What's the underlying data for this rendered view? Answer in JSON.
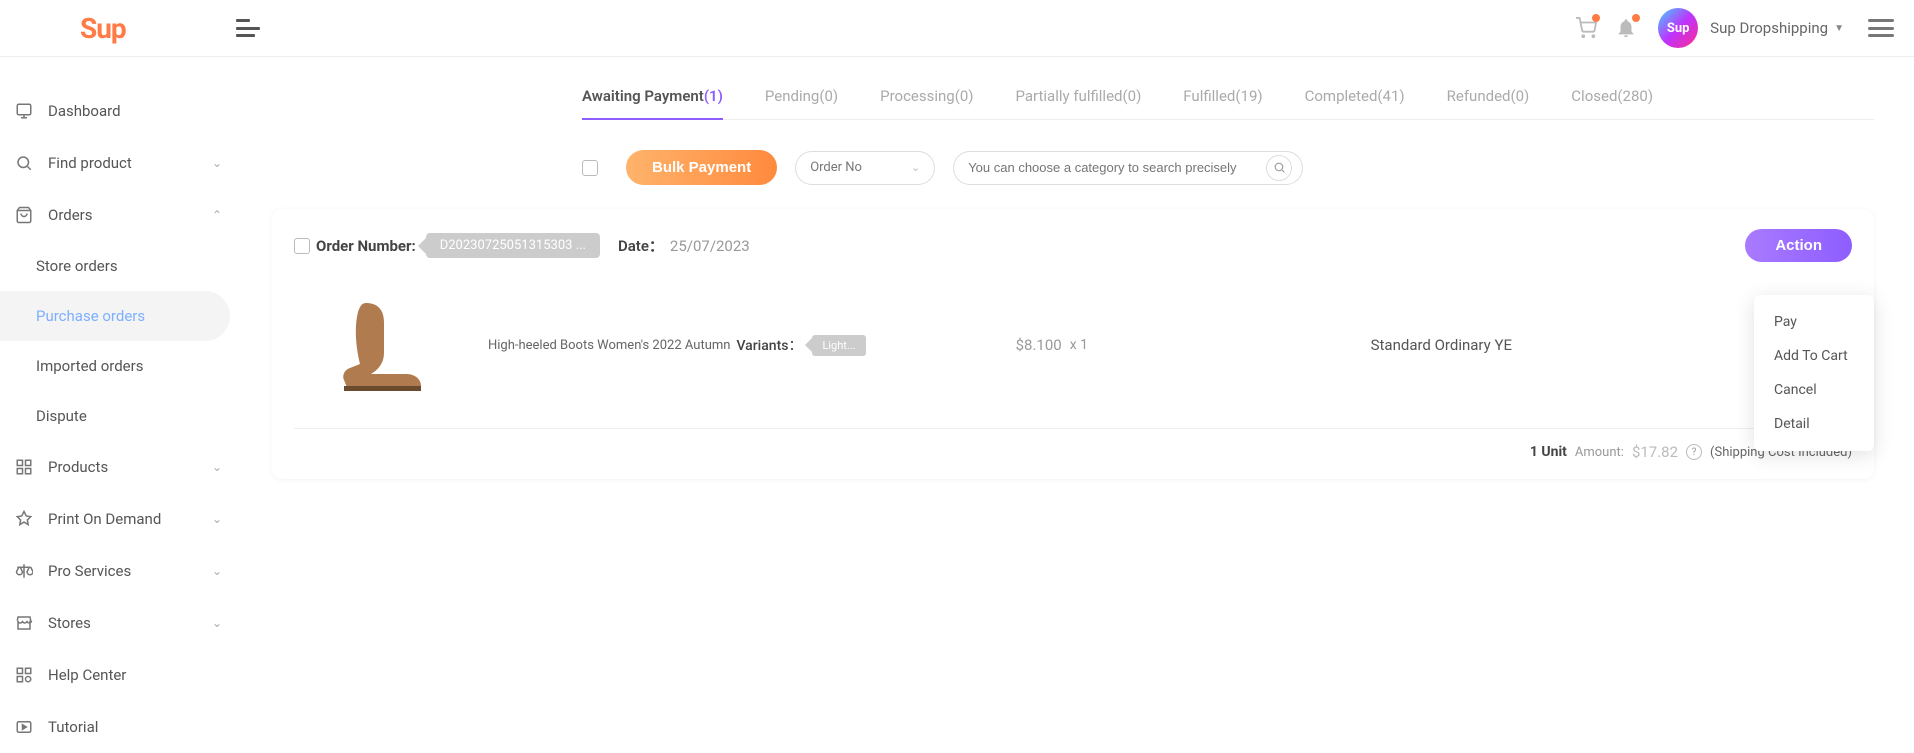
{
  "header": {
    "logo": "Sup",
    "user": "Sup Dropshipping"
  },
  "sidebar": {
    "dashboard": "Dashboard",
    "find_product": "Find product",
    "orders": "Orders",
    "orders_sub": {
      "store_orders": "Store orders",
      "purchase_orders": "Purchase orders",
      "imported_orders": "Imported orders",
      "dispute": "Dispute"
    },
    "products": "Products",
    "pod": "Print On Demand",
    "pro_services": "Pro Services",
    "stores": "Stores",
    "help": "Help Center",
    "tutorial": "Tutorial"
  },
  "tabs": {
    "awaiting": {
      "label": "Awaiting Payment",
      "count": "(1)"
    },
    "pending": {
      "label": "Pending",
      "count": "(0)"
    },
    "processing": {
      "label": "Processing",
      "count": "(0)"
    },
    "partial": {
      "label": "Partially fulfilled",
      "count": "(0)"
    },
    "fulfilled": {
      "label": "Fulfilled",
      "count": "(19)"
    },
    "completed": {
      "label": "Completed",
      "count": "(41)"
    },
    "refunded": {
      "label": "Refunded",
      "count": "(0)"
    },
    "closed": {
      "label": "Closed",
      "count": "(280)"
    }
  },
  "toolbar": {
    "bulk_payment": "Bulk Payment",
    "select_value": "Order No",
    "search_placeholder": "You can choose a category to search precisely"
  },
  "order": {
    "order_number_label": "Order Number:",
    "order_number_value": "D20230725051315303 ...",
    "date_label": "Date：",
    "date_value": "25/07/2023",
    "action_label": "Action",
    "menu": {
      "pay": "Pay",
      "add_to_cart": "Add To Cart",
      "cancel": "Cancel",
      "detail": "Detail"
    },
    "product_name": "High-heeled Boots Women's 2022 Autumn",
    "variants_label": "Variants：",
    "variant_value": "Light...",
    "price": "$8.100",
    "qty": "x 1",
    "shipping_method": "Standard Ordinary YE",
    "unit": "1 Unit",
    "amount_label": "Amount:",
    "amount_value": "$17.82",
    "shipping_note": "(Shipping Cost Included)"
  }
}
